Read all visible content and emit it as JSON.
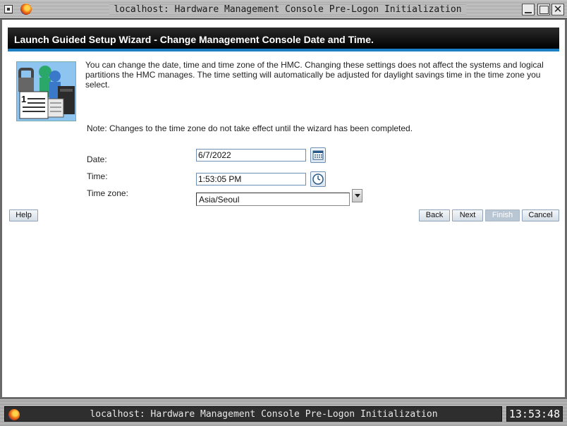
{
  "window": {
    "title": "localhost: Hardware Management Console Pre-Logon Initialization"
  },
  "page": {
    "title": "Launch Guided Setup Wizard - Change Management Console Date and Time.",
    "intro": "You can change the date, time and time zone of the HMC. Changing these settings does not affect the systems and logical partitions the HMC manages. The time setting will automatically be adjusted for daylight savings time in the time zone you select.",
    "note": "Note: Changes to the time zone do not take effect until the wizard has been completed."
  },
  "form": {
    "date_label": "Date:",
    "date_value": "6/7/2022",
    "time_label": "Time:",
    "time_value": "1:53:05 PM",
    "timezone_label": "Time zone:",
    "timezone_value": "Asia/Seoul"
  },
  "buttons": {
    "help": "Help",
    "back": "Back",
    "next": "Next",
    "finish": "Finish",
    "cancel": "Cancel"
  },
  "taskbar": {
    "task_title": "localhost: Hardware Management Console Pre-Logon Initialization",
    "clock": "13:53:48"
  },
  "colors": {
    "header_band": "#000000",
    "header_accent": "#1c7fc4",
    "input_border": "#6c8fb5"
  },
  "icons": [
    "window-menu-icon",
    "firefox-icon",
    "minimize-icon",
    "maximize-icon",
    "close-icon",
    "calendar-icon",
    "clock-icon",
    "dropdown-arrow-icon"
  ]
}
